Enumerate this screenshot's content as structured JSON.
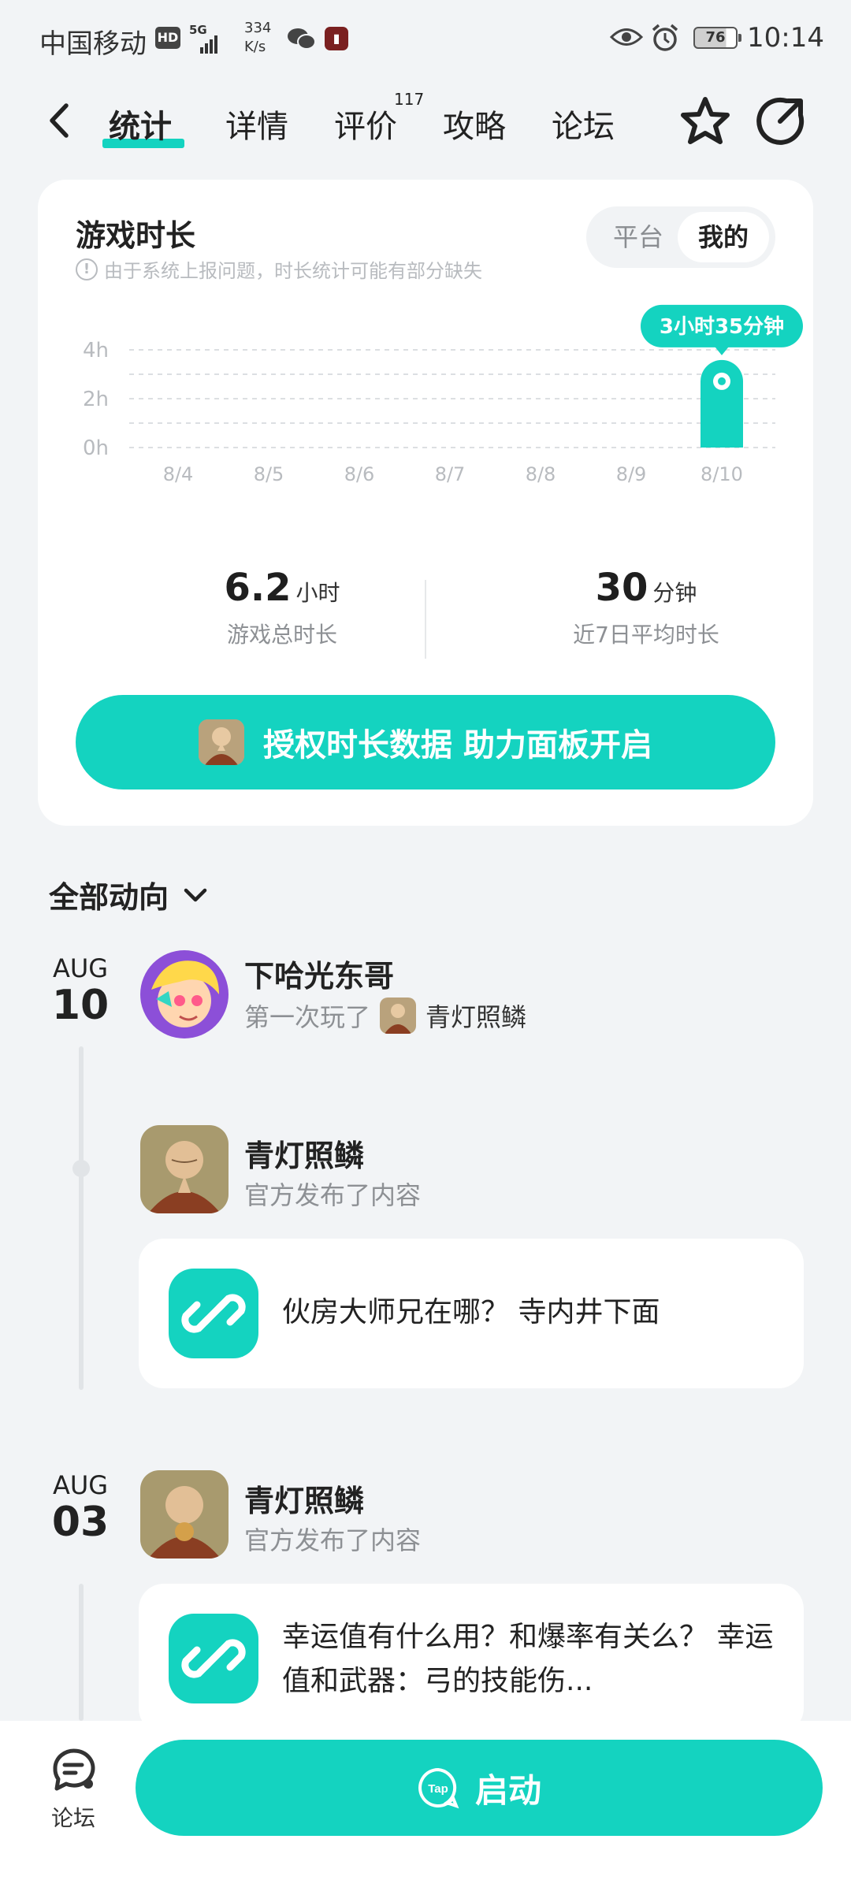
{
  "status_bar": {
    "carrier": "中国移动",
    "hd": "HD",
    "network": "5G",
    "speed_value": "334",
    "speed_unit": "K/s",
    "battery": "76",
    "time": "10:14"
  },
  "nav": {
    "tabs": [
      {
        "label": "统计",
        "active": true
      },
      {
        "label": "详情",
        "active": false
      },
      {
        "label": "评价",
        "active": false,
        "badge": "117"
      },
      {
        "label": "攻略",
        "active": false
      },
      {
        "label": "论坛",
        "active": false
      }
    ]
  },
  "stats": {
    "title": "游戏时长",
    "note": "由于系统上报问题，时长统计可能有部分缺失",
    "toggle": {
      "options": [
        "平台",
        "我的"
      ],
      "selected": "我的"
    },
    "total": {
      "value": "6.2",
      "unit": "小时",
      "label": "游戏总时长"
    },
    "average": {
      "value": "30",
      "unit": "分钟",
      "label": "近7日平均时长"
    },
    "auth_button": "授权时长数据 助力面板开启"
  },
  "chart_data": {
    "type": "bar",
    "categories": [
      "8/4",
      "8/5",
      "8/6",
      "8/7",
      "8/8",
      "8/9",
      "8/10"
    ],
    "values": [
      0,
      0,
      0,
      0,
      0,
      0,
      3.583
    ],
    "unit": "h",
    "y_ticks": [
      "0h",
      "2h",
      "4h"
    ],
    "ylim": [
      0,
      4
    ],
    "highlight": {
      "category": "8/10",
      "label": "3小时35分钟"
    },
    "grid": true,
    "bar_color": "#14d3c0"
  },
  "feed": {
    "header": "全部动向",
    "groups": [
      {
        "month": "AUG",
        "day": "10",
        "entries": [
          {
            "name": "下哈光东哥",
            "action": "第一次玩了",
            "game": "青灯照鳞"
          },
          {
            "name": "青灯照鳞",
            "action": "官方发布了内容",
            "post": "伙房大师兄在哪？ 寺内井下面"
          }
        ]
      },
      {
        "month": "AUG",
        "day": "03",
        "entries": [
          {
            "name": "青灯照鳞",
            "action": "官方发布了内容",
            "post": "幸运值有什么用？和爆率有关么？ 幸运值和武器：弓的技能伤..."
          }
        ]
      }
    ]
  },
  "bottom": {
    "forum_label": "论坛",
    "launch_label": "启动",
    "tap_logo": "Tap"
  },
  "colors": {
    "accent": "#14d3c0",
    "background": "#f2f4f6"
  }
}
